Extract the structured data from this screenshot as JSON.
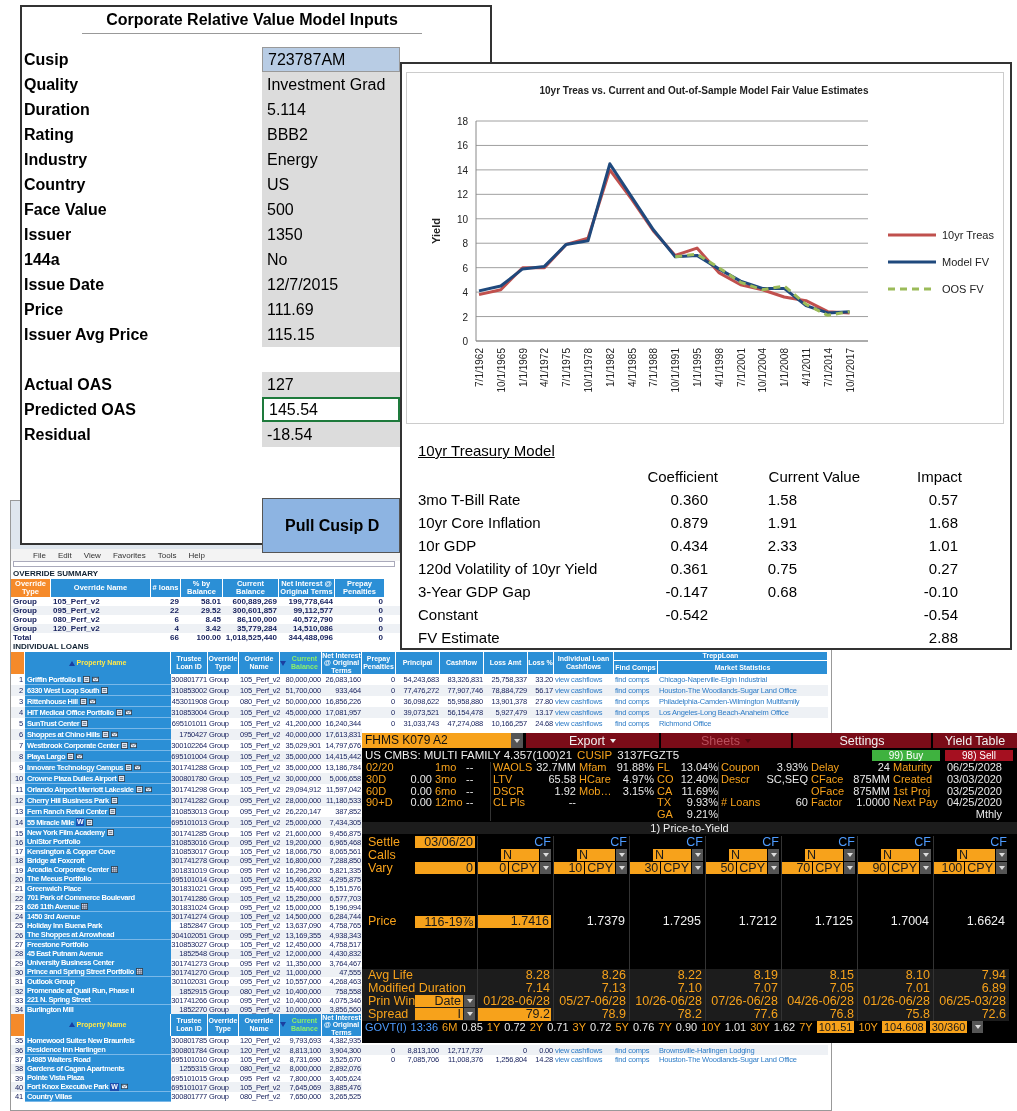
{
  "spreadsheet": {
    "menu": [
      "File",
      "Edit",
      "View",
      "Favorites",
      "Tools",
      "Help"
    ],
    "summary_title": "OVERRIDE SUMMARY",
    "summary_columns": [
      "Override Type",
      "Override Name",
      "# loans",
      "% by Balance",
      "Current Balance",
      "Net Interest @ Original Terms",
      "Prepay Penalties"
    ],
    "summary_rows": [
      {
        "type": "Group",
        "name": "105_Perf_v2",
        "loans": "29",
        "pct": "58.01",
        "balance": "600,889,269",
        "net": "199,778,644",
        "prepay": "0"
      },
      {
        "type": "Group",
        "name": "095_Perf_v2",
        "loans": "22",
        "pct": "29.52",
        "balance": "300,601,857",
        "net": "99,112,577",
        "prepay": "0"
      },
      {
        "type": "Group",
        "name": "080_Perf_v2",
        "loans": "6",
        "pct": "8.45",
        "balance": "86,100,000",
        "net": "40,572,790",
        "prepay": "0"
      },
      {
        "type": "Group",
        "name": "120_Perf_v2",
        "loans": "4",
        "pct": "3.42",
        "balance": "35,779,284",
        "net": "14,510,086",
        "prepay": "0"
      },
      {
        "type": "Total",
        "loans": "66",
        "pct": "100.00",
        "balance": "1,018,525,440",
        "net": "344,488,096",
        "prepay": "0"
      }
    ],
    "loans_title": "INDIVIDUAL LOANS",
    "loans": [
      {
        "kind": "header",
        "trepp": "TreppLoan",
        "columns": [
          {
            "label": "Property Name",
            "sorted_up": true,
            "sorted_down": false
          },
          {
            "label": "Trustee Loan ID",
            "sorted_up": false,
            "sorted_down": false
          },
          {
            "label": "Override Type",
            "sorted_up": false,
            "sorted_down": false
          },
          {
            "label": "Override Name",
            "sorted_up": false,
            "sorted_down": false
          },
          {
            "label": "Current Balance",
            "sorted_up": false,
            "sorted_down": true
          },
          {
            "label": "Net Interest @ Original Terms",
            "sorted_up": false,
            "sorted_down": false
          },
          {
            "label": "Prepay Penalties",
            "sorted_up": false,
            "sorted_down": false
          },
          {
            "label": "Principal",
            "sorted_up": false,
            "sorted_down": false
          },
          {
            "label": "Cashflow",
            "sorted_up": false,
            "sorted_down": false
          },
          {
            "label": "Loss Amt",
            "sorted_up": false,
            "sorted_down": false
          },
          {
            "label": "Loss %",
            "sorted_up": false,
            "sorted_down": false
          },
          {
            "label": "Individual Loan Cashflows",
            "sorted_up": false,
            "sorted_down": false
          },
          {
            "label": "Find Comps",
            "sorted_up": false,
            "sorted_down": false
          },
          {
            "label": "Market Statistics",
            "sorted_up": false,
            "sorted_down": false
          }
        ]
      },
      {
        "kind": "loan",
        "num": "1",
        "name": "Griffin Portfolio II",
        "icons": [
          {
            "kind": "doc"
          },
          {
            "kind": "mail"
          }
        ],
        "cells": [
          "300801771",
          "Group",
          "105_Perf_v2",
          "80,000,000",
          "26,083,160"
        ],
        "extra": [
          "0",
          "54,243,683",
          "83,326,831",
          "25,758,337",
          "33.20",
          "view cashflows",
          "find comps",
          "Chicago-Naperville-Elgin Industrial"
        ]
      },
      {
        "kind": "loan",
        "num": "2",
        "name": "6330 West Loop South",
        "icons": [
          {
            "kind": "doc"
          }
        ],
        "cells": [
          "310853002",
          "Group",
          "105_Perf_v2",
          "51,700,000",
          "933,464"
        ],
        "extra": [
          "0",
          "77,476,272",
          "77,907,746",
          "78,884,729",
          "56.17",
          "view cashflows",
          "find comps",
          "Houston-The Woodlands-Sugar Land Office"
        ]
      },
      {
        "kind": "loan",
        "num": "3",
        "name": "Rittenhouse Hill",
        "icons": [
          {
            "kind": "doc"
          },
          {
            "kind": "mail"
          }
        ],
        "cells": [
          "453011908",
          "Group",
          "080_Perf_v2",
          "50,000,000",
          "16,856,226"
        ],
        "extra": [
          "0",
          "36,098,622",
          "55,958,880",
          "13,901,378",
          "27.80",
          "view cashflows",
          "find comps",
          "Philadelphia-Camden-Wilmington Multifamily"
        ]
      },
      {
        "kind": "loan",
        "num": "4",
        "name": "HIT Medical Office Portfolio",
        "icons": [
          {
            "kind": "doc"
          },
          {
            "kind": "mail"
          }
        ],
        "cells": [
          "310853004",
          "Group",
          "105_Perf_v2",
          "45,000,000",
          "17,081,957"
        ],
        "extra": [
          "0",
          "39,073,521",
          "56,154,478",
          "5,927,479",
          "13.17",
          "view cashflows",
          "find comps",
          "Los Angeles-Long Beach-Anaheim Office"
        ]
      },
      {
        "kind": "loan",
        "num": "5",
        "name": "SunTrust Center",
        "icons": [
          {
            "kind": "doc"
          }
        ],
        "cells": [
          "695101011",
          "Group",
          "105_Perf_v2",
          "41,200,000",
          "16,240,344"
        ],
        "extra": [
          "0",
          "31,033,743",
          "47,274,088",
          "10,166,257",
          "24.68",
          "view cashflows",
          "find comps",
          "Richmond Office"
        ]
      },
      {
        "kind": "loan",
        "num": "6",
        "name": "Shoppes at Chino Hills",
        "icons": [
          {
            "kind": "doc"
          },
          {
            "kind": "mail"
          }
        ],
        "cells": [
          "1750427",
          "Group",
          "095_Perf_v2",
          "40,000,000",
          "17,613,831"
        ]
      },
      {
        "kind": "loan",
        "num": "7",
        "name": "Westbrook Corporate Center",
        "icons": [
          {
            "kind": "doc"
          },
          {
            "kind": "mail"
          }
        ],
        "cells": [
          "300102264",
          "Group",
          "105_Perf_v2",
          "35,029,901",
          "14,797,676"
        ]
      },
      {
        "kind": "loan",
        "num": "8",
        "name": "Playa Largo",
        "icons": [
          {
            "kind": "doc"
          },
          {
            "kind": "mail"
          }
        ],
        "cells": [
          "695101004",
          "Group",
          "105_Perf_v2",
          "35,000,000",
          "14,415,442"
        ]
      },
      {
        "kind": "loan",
        "num": "9",
        "name": "Innovare Technology Campus",
        "icons": [
          {
            "kind": "doc"
          },
          {
            "kind": "mail"
          }
        ],
        "cells": [
          "301741288",
          "Group",
          "105_Perf_v2",
          "35,000,000",
          "13,186,784"
        ]
      },
      {
        "kind": "loan",
        "num": "10",
        "name": "Crowne Plaza Dulles Airport",
        "icons": [
          {
            "kind": "doc"
          }
        ],
        "cells": [
          "300801780",
          "Group",
          "105_Perf_v2",
          "30,000,000",
          "5,006,658"
        ]
      },
      {
        "kind": "loan",
        "num": "11",
        "name": "Orlando Airport Marriott Lakeside",
        "icons": [
          {
            "kind": "doc"
          },
          {
            "kind": "mail"
          }
        ],
        "cells": [
          "301741298",
          "Group",
          "105_Perf_v2",
          "29,094,912",
          "11,597,042"
        ]
      },
      {
        "kind": "loan",
        "num": "12",
        "name": "Cherry Hill Business Park",
        "icons": [
          {
            "kind": "doc"
          }
        ],
        "cells": [
          "301741282",
          "Group",
          "095_Perf_v2",
          "28,000,000",
          "11,180,533"
        ]
      },
      {
        "kind": "loan",
        "num": "13",
        "name": "Fern Ranch Retail Center",
        "icons": [
          {
            "kind": "doc"
          }
        ],
        "cells": [
          "310853013",
          "Group",
          "095_Perf_v2",
          "26,220,147",
          "387,852"
        ]
      },
      {
        "kind": "loan",
        "num": "14",
        "name": "55 Miracle Mile",
        "icons": [
          {
            "kind": "word",
            "label": "W"
          },
          {
            "kind": "doc"
          }
        ],
        "cells": [
          "695101013",
          "Group",
          "105_Perf_v2",
          "25,000,000",
          "7,434,305"
        ]
      },
      {
        "kind": "loan",
        "num": "15",
        "name": "New York Film Academy",
        "icons": [
          {
            "kind": "doc"
          }
        ],
        "cells": [
          "301741285",
          "Group",
          "105_Perf_v2",
          "21,600,000",
          "9,456,875"
        ]
      },
      {
        "kind": "loan",
        "num": "16",
        "name": "UniStor Portfolio",
        "cells": [
          "310853016",
          "Group",
          "095_Perf_v2",
          "19,200,000",
          "6,965,468"
        ]
      },
      {
        "kind": "loan",
        "num": "17",
        "name": "Kensington & Copper Cove",
        "cells": [
          "310853017",
          "Group",
          "105_Perf_v2",
          "18,066,750",
          "8,065,561"
        ]
      },
      {
        "kind": "loan",
        "num": "18",
        "name": "Bridge at Foxcroft",
        "cells": [
          "301741278",
          "Group",
          "095_Perf_v2",
          "16,800,000",
          "7,288,850"
        ]
      },
      {
        "kind": "loan",
        "num": "19",
        "name": "Arcadia Corporate Center",
        "icons": [
          {
            "kind": "calc"
          }
        ],
        "cells": [
          "301831019",
          "Group",
          "095_Perf_v2",
          "16,296,200",
          "5,821,335"
        ]
      },
      {
        "kind": "loan",
        "num": "20",
        "name": "The Meeus Portfolio",
        "cells": [
          "695101014",
          "Group",
          "105_Perf_v2",
          "15,406,832",
          "4,295,875"
        ]
      },
      {
        "kind": "loan",
        "num": "21",
        "name": "Greenwich Place",
        "cells": [
          "301831021",
          "Group",
          "095_Perf_v2",
          "15,400,000",
          "5,151,576"
        ]
      },
      {
        "kind": "loan",
        "num": "22",
        "name": "701 Park of Commerce Boulevard",
        "cells": [
          "301741286",
          "Group",
          "105_Perf_v2",
          "15,250,000",
          "6,577,703"
        ]
      },
      {
        "kind": "loan",
        "num": "23",
        "name": "626 11th Avenue",
        "icons": [
          {
            "kind": "calc"
          }
        ],
        "cells": [
          "301831024",
          "Group",
          "095_Perf_v2",
          "15,000,000",
          "5,196,994"
        ]
      },
      {
        "kind": "loan",
        "num": "24",
        "name": "1450 3rd Avenue",
        "cells": [
          "301741274",
          "Group",
          "105_Perf_v2",
          "14,500,000",
          "6,284,744"
        ]
      },
      {
        "kind": "loan",
        "num": "25",
        "name": "Holiday Inn Buena Park",
        "cells": [
          "1852847",
          "Group",
          "105_Perf_v2",
          "13,637,090",
          "4,758,765"
        ]
      },
      {
        "kind": "loan",
        "num": "26",
        "name": "The Shoppes at Arrowhead",
        "cells": [
          "304102051",
          "Group",
          "095_Perf_v2",
          "13,169,355",
          "4,938,343"
        ]
      },
      {
        "kind": "loan",
        "num": "27",
        "name": "Freestone Portfolio",
        "cells": [
          "310853027",
          "Group",
          "105_Perf_v2",
          "12,450,000",
          "4,758,517"
        ]
      },
      {
        "kind": "loan",
        "num": "28",
        "name": "45 East Putnam Avenue",
        "cells": [
          "1852548",
          "Group",
          "105_Perf_v2",
          "12,000,000",
          "4,430,832"
        ]
      },
      {
        "kind": "loan",
        "num": "29",
        "name": "University Business Center",
        "cells": [
          "301741273",
          "Group",
          "095_Perf_v2",
          "11,350,000",
          "3,764,467"
        ]
      },
      {
        "kind": "loan",
        "num": "30",
        "name": "Prince and Spring Street Portfolio",
        "icons": [
          {
            "kind": "calc"
          }
        ],
        "cells": [
          "301741270",
          "Group",
          "105_Perf_v2",
          "11,000,000",
          "47,555"
        ]
      },
      {
        "kind": "loan",
        "num": "31",
        "name": "Outlook Group",
        "cells": [
          "301102031",
          "Group",
          "095_Perf_v2",
          "10,557,000",
          "4,268,463"
        ]
      },
      {
        "kind": "loan",
        "num": "32",
        "name": "Promenade at Quail Run, Phase II",
        "cells": [
          "1852915",
          "Group",
          "080_Perf_v2",
          "10,400,000",
          "758,558"
        ]
      },
      {
        "kind": "loan",
        "num": "33",
        "name": "221 N. Spring Street",
        "cells": [
          "301741266",
          "Group",
          "095_Perf_v2",
          "10,400,000",
          "4,075,346"
        ]
      },
      {
        "kind": "loan",
        "num": "34",
        "name": "Burlington Mill",
        "cells": [
          "1852270",
          "Group",
          "095_Perf_v2",
          "10,000,000",
          "3,856,560"
        ]
      },
      {
        "kind": "header",
        "columns": [
          {
            "label": "Property Name",
            "sorted_up": true,
            "sorted_down": false
          },
          {
            "label": "Trustee Loan ID",
            "sorted_up": false,
            "sorted_down": false
          },
          {
            "label": "Override Type",
            "sorted_up": false,
            "sorted_down": false
          },
          {
            "label": "Override Name",
            "sorted_up": false,
            "sorted_down": false
          },
          {
            "label": "Current Balance",
            "sorted_up": false,
            "sorted_down": true
          },
          {
            "label": "Net Interest @ Original Terms",
            "sorted_up": false,
            "sorted_down": false
          }
        ]
      },
      {
        "kind": "loan",
        "num": "35",
        "name": "Homewood Suites New Braunfels",
        "cells": [
          "300801785",
          "Group",
          "120_Perf_v2",
          "9,793,693",
          "4,382,935"
        ]
      },
      {
        "kind": "loan",
        "num": "36",
        "name": "Residence Inn Harlingen",
        "cells": [
          "300801784",
          "Group",
          "120_Perf_v2",
          "8,813,100",
          "3,904,300"
        ],
        "extra": [
          "0",
          "8,813,100",
          "12,717,737",
          "0",
          "0.00",
          "view cashflows",
          "find comps",
          "Brownsville-Harlingen Lodging"
        ]
      },
      {
        "kind": "loan",
        "num": "37",
        "name": "14985 Walters Road",
        "cells": [
          "695101010",
          "Group",
          "105_Perf_v2",
          "8,731,690",
          "3,525,670"
        ],
        "extra": [
          "0",
          "7,085,706",
          "11,008,376",
          "1,256,804",
          "14.28",
          "view cashflows",
          "find comps",
          "Houston-The Woodlands-Sugar Land Office"
        ]
      },
      {
        "kind": "loan",
        "num": "38",
        "name": "Gardens of Cagan Apartments",
        "cells": [
          "1255315",
          "Group",
          "080_Perf_v2",
          "8,000,000",
          "2,892,076"
        ]
      },
      {
        "kind": "loan",
        "num": "39",
        "name": "Pointe Vista Plaza",
        "cells": [
          "695101015",
          "Group",
          "095_Perf_v2",
          "7,800,000",
          "3,405,624"
        ]
      },
      {
        "kind": "loan",
        "num": "40",
        "name": "Fort Knox Executive Park",
        "icons": [
          {
            "kind": "word",
            "label": "W"
          },
          {
            "kind": "mail"
          }
        ],
        "cells": [
          "695101017",
          "Group",
          "105_Perf_v2",
          "7,645,069",
          "3,885,476"
        ]
      },
      {
        "kind": "loan",
        "num": "41",
        "name": "Country Villas",
        "cells": [
          "300801777",
          "Group",
          "080_Perf_v2",
          "7,650,000",
          "3,265,525"
        ]
      }
    ]
  },
  "inputs": {
    "title": "Corporate Relative Value Model Inputs",
    "fields": [
      {
        "label": "Cusip",
        "value": "723787AM",
        "kind": "input",
        "selected": false
      },
      {
        "label": "Quality",
        "value": "Investment Grad",
        "kind": "value",
        "selected": false
      },
      {
        "label": "Duration",
        "value": "5.114",
        "kind": "value",
        "selected": false
      },
      {
        "label": "Rating",
        "value": "BBB2",
        "kind": "value",
        "selected": false
      },
      {
        "label": "Industry",
        "value": "Energy",
        "kind": "value",
        "selected": false
      },
      {
        "label": "Country",
        "value": "US",
        "kind": "value",
        "selected": false
      },
      {
        "label": "Face Value",
        "value": "500",
        "kind": "value",
        "selected": false
      },
      {
        "label": "Issuer",
        "value": "1350",
        "kind": "value",
        "selected": false
      },
      {
        "label": "144a",
        "value": "No",
        "kind": "value",
        "selected": false
      },
      {
        "label": "Issue Date",
        "value": "12/7/2015",
        "kind": "value",
        "selected": false
      },
      {
        "label": "Price",
        "value": "111.69",
        "kind": "value",
        "selected": false
      },
      {
        "label": "Issuer Avg Price",
        "value": "115.15",
        "kind": "value",
        "selected": false
      }
    ],
    "oas_fields": [
      {
        "label": "Actual OAS",
        "value": "127",
        "kind": "value",
        "selected": false
      },
      {
        "label": "Predicted OAS",
        "value": "145.54",
        "kind": "plain",
        "selected": true
      },
      {
        "label": "Residual",
        "value": "-18.54",
        "kind": "value",
        "selected": false
      }
    ],
    "button": "Pull Cusip D"
  },
  "chart_window": {
    "chart_data": {
      "type": "line",
      "title": "10yr Treas vs. Current and Out-of-Sample Model Fair Value Estimates",
      "ylabel": "Yield",
      "categories": [
        "7/1/1962",
        "10/1/1965",
        "1/1/1969",
        "4/1/1972",
        "7/1/1975",
        "10/1/1978",
        "1/1/1982",
        "4/1/1985",
        "7/1/1988",
        "10/1/1991",
        "1/1/1995",
        "4/1/1998",
        "7/1/2001",
        "10/1/2004",
        "1/1/2008",
        "4/1/2011",
        "7/1/2014",
        "10/1/2017"
      ],
      "series": [
        {
          "name": "10yr Treas",
          "color": "#c0504d",
          "line_style": "solid",
          "values": [
            3.8,
            4.2,
            6.0,
            6.0,
            7.9,
            8.4,
            14.0,
            11.6,
            9.0,
            7.0,
            7.6,
            5.6,
            4.6,
            4.2,
            3.6,
            3.3,
            2.4,
            2.3
          ]
        },
        {
          "name": "Model FV",
          "color": "#1f497d",
          "line_style": "solid",
          "values": [
            4.1,
            4.5,
            5.9,
            6.1,
            7.9,
            8.2,
            14.5,
            11.8,
            9.1,
            6.9,
            7.0,
            5.9,
            4.9,
            4.3,
            4.3,
            2.9,
            2.3,
            2.4
          ]
        },
        {
          "name": "OOS FV",
          "color": "#9bbb59",
          "line_style": "dashed",
          "values": [
            null,
            null,
            null,
            null,
            null,
            null,
            null,
            null,
            null,
            6.9,
            7.1,
            6.0,
            4.8,
            4.2,
            4.5,
            3.0,
            2.1,
            2.4
          ]
        }
      ],
      "ylim": [
        0,
        18
      ],
      "yticks": [
        0,
        2,
        4,
        6,
        8,
        10,
        12,
        14,
        16,
        18
      ],
      "grid": true,
      "legend": true
    },
    "model": {
      "title": "10yr Treasury Model",
      "columns": [
        "Coefficient",
        "Current Value",
        "Impact"
      ],
      "rows": [
        {
          "label": "3mo T-Bill Rate",
          "coefficient": "0.360",
          "current": "1.58",
          "impact": "0.57"
        },
        {
          "label": "10yr Core Inflation",
          "coefficient": "0.879",
          "current": "1.91",
          "impact": "1.68"
        },
        {
          "label": "10r GDP",
          "coefficient": "0.434",
          "current": "2.33",
          "impact": "1.01"
        },
        {
          "label": "120d Volatility of 10yr Yield",
          "coefficient": "0.361",
          "current": "0.75",
          "impact": "0.27"
        },
        {
          "label": "3-Year GDP Gap",
          "coefficient": "-0.147",
          "current": "0.68",
          "impact": "-0.10"
        },
        {
          "label": "Constant",
          "coefficient": "-0.542",
          "impact": "-0.54"
        },
        {
          "label": "FV Estimate",
          "impact": "2.88"
        }
      ]
    }
  },
  "bloomberg": {
    "security": "FHMS K079 A2",
    "menus": [
      {
        "label": "Export",
        "dropdown": true,
        "disabled": false
      },
      {
        "label": "Sheets",
        "dropdown": true,
        "disabled": true
      },
      {
        "label": "Settings",
        "dropdown": false,
        "disabled": false
      },
      {
        "label": "Yield Table",
        "dropdown": false,
        "disabled": false
      }
    ],
    "description": "US CMBS: MULTI FAMILY 4.357(100)21",
    "cusip_label": "CUSIP",
    "cusip": "3137FGZT5",
    "actions": [
      {
        "label": "99) Buy",
        "kind": "buy"
      },
      {
        "label": "98) Sell",
        "kind": "sell"
      }
    ],
    "stats": [
      [
        {
          "kind": "field",
          "label": "02/20"
        },
        {
          "kind": "field",
          "label": "1mo",
          "value": "--"
        },
        {
          "kind": "field",
          "label": "WAOLS",
          "value": "32.7MM"
        },
        {
          "kind": "field",
          "label": "Mfam",
          "value": "91.88%"
        },
        {
          "kind": "field",
          "label": "FL",
          "value": "13.04%"
        },
        {
          "kind": "field",
          "label": "Coupon",
          "value": "3.93%"
        },
        {
          "kind": "field",
          "label": "Delay",
          "value": "24"
        },
        {
          "kind": "field",
          "label": "Maturity",
          "value": "06/25/2028"
        }
      ],
      [
        {
          "kind": "field",
          "label": "30D",
          "value": "0.00"
        },
        {
          "kind": "field",
          "label": "3mo",
          "value": "--"
        },
        {
          "kind": "field",
          "label": "LTV",
          "value": "65.58"
        },
        {
          "kind": "field",
          "label": "HCare",
          "value": "4.97%"
        },
        {
          "kind": "field",
          "label": "CO",
          "value": "12.40%"
        },
        {
          "kind": "field",
          "label": "Descr",
          "value": "SC,SEQ"
        },
        {
          "kind": "field",
          "label": "CFace",
          "value": "875MM"
        },
        {
          "kind": "field",
          "label": "Created",
          "value": "03/03/2020"
        }
      ],
      [
        {
          "kind": "field",
          "label": "60D",
          "value": "0.00"
        },
        {
          "kind": "field",
          "label": "6mo",
          "value": "--"
        },
        {
          "kind": "field",
          "label": "DSCR",
          "value": "1.92"
        },
        {
          "kind": "field",
          "label": "Mob…",
          "value": "3.15%"
        },
        {
          "kind": "field",
          "label": "CA",
          "value": "11.69%"
        },
        {
          "kind": "blank"
        },
        {
          "kind": "field",
          "label": "OFace",
          "value": "875MM"
        },
        {
          "kind": "field",
          "label": "1st Proj",
          "value": "03/25/2020"
        }
      ],
      [
        {
          "kind": "field",
          "label": "90+D",
          "value": "0.00"
        },
        {
          "kind": "field",
          "label": "12mo",
          "value": "--"
        },
        {
          "kind": "field",
          "label": "CL Pls",
          "value": "--"
        },
        {
          "kind": "blank"
        },
        {
          "kind": "field",
          "label": "TX",
          "value": "9.93%"
        },
        {
          "kind": "field",
          "label": "# Loans",
          "value": "60"
        },
        {
          "kind": "field",
          "label": "Factor",
          "value": "1.0000"
        },
        {
          "kind": "field",
          "label": "Next Pay",
          "value": "04/25/2020"
        }
      ],
      [
        {
          "kind": "blank"
        },
        {
          "kind": "blank"
        },
        {
          "kind": "blank"
        },
        {
          "kind": "blank"
        },
        {
          "kind": "field",
          "label": "GA",
          "value": "9.21%"
        },
        {
          "kind": "blank"
        },
        {
          "kind": "blank"
        },
        {
          "kind": "field",
          "value": "Mthly"
        }
      ]
    ],
    "section": "1) Price-to-Yield",
    "labels": {
      "settle": "Settle",
      "calls": "Calls",
      "vary": "Vary",
      "price": "Price",
      "avg_life": "Avg Life",
      "mod_dur": "Modified Duration",
      "prin_win": "Prin Win",
      "spread": "Spread"
    },
    "settle": "03/06/20",
    "vary": "0",
    "price": "116-19⅞",
    "prin_win_mode": "Date",
    "spread_mode": "I",
    "scenarios": [
      {
        "cf": "CF",
        "calls": "N",
        "vary": "0",
        "vary_unit": "CPY",
        "price": "1.7416",
        "avg_life": "8.28",
        "mod_dur": "7.14",
        "prin_win": "01/28-06/28",
        "spread": "79.2",
        "selected": true
      },
      {
        "cf": "CF",
        "calls": "N",
        "vary": "10",
        "vary_unit": "CPY",
        "price": "1.7379",
        "avg_life": "8.26",
        "mod_dur": "7.13",
        "prin_win": "05/27-06/28",
        "spread": "78.9",
        "selected": false
      },
      {
        "cf": "CF",
        "calls": "N",
        "vary": "30",
        "vary_unit": "CPY",
        "price": "1.7295",
        "avg_life": "8.22",
        "mod_dur": "7.10",
        "prin_win": "10/26-06/28",
        "spread": "78.2",
        "selected": false
      },
      {
        "cf": "CF",
        "calls": "N",
        "vary": "50",
        "vary_unit": "CPY",
        "price": "1.7212",
        "avg_life": "8.19",
        "mod_dur": "7.07",
        "prin_win": "07/26-06/28",
        "spread": "77.6",
        "selected": false
      },
      {
        "cf": "CF",
        "calls": "N",
        "vary": "70",
        "vary_unit": "CPY",
        "price": "1.7125",
        "avg_life": "8.15",
        "mod_dur": "7.05",
        "prin_win": "04/26-06/28",
        "spread": "76.8",
        "selected": false
      },
      {
        "cf": "CF",
        "calls": "N",
        "vary": "90",
        "vary_unit": "CPY",
        "price": "1.7004",
        "avg_life": "8.10",
        "mod_dur": "7.01",
        "prin_win": "01/26-06/28",
        "spread": "75.8",
        "selected": false
      },
      {
        "cf": "CF",
        "calls": "N",
        "vary": "100",
        "vary_unit": "CPY",
        "price": "1.6624",
        "avg_life": "7.94",
        "mod_dur": "6.89",
        "prin_win": "06/25-03/28",
        "spread": "72.6",
        "selected": false
      }
    ],
    "govt": {
      "label": "GOVT(I)",
      "time": "13:36",
      "rates": [
        {
          "tenor": "6M",
          "rate": "0.85"
        },
        {
          "tenor": "1Y",
          "rate": "0.72"
        },
        {
          "tenor": "2Y",
          "rate": "0.71"
        },
        {
          "tenor": "3Y",
          "rate": "0.72"
        },
        {
          "tenor": "5Y",
          "rate": "0.76"
        },
        {
          "tenor": "7Y",
          "rate": "0.90"
        },
        {
          "tenor": "10Y",
          "rate": "1.01"
        },
        {
          "tenor": "30Y",
          "rate": "1.62"
        }
      ],
      "fields": [
        {
          "label": "7Y",
          "value": "101.51"
        },
        {
          "label": "10Y",
          "value": "104.608"
        }
      ],
      "daycount": "30/360"
    }
  }
}
